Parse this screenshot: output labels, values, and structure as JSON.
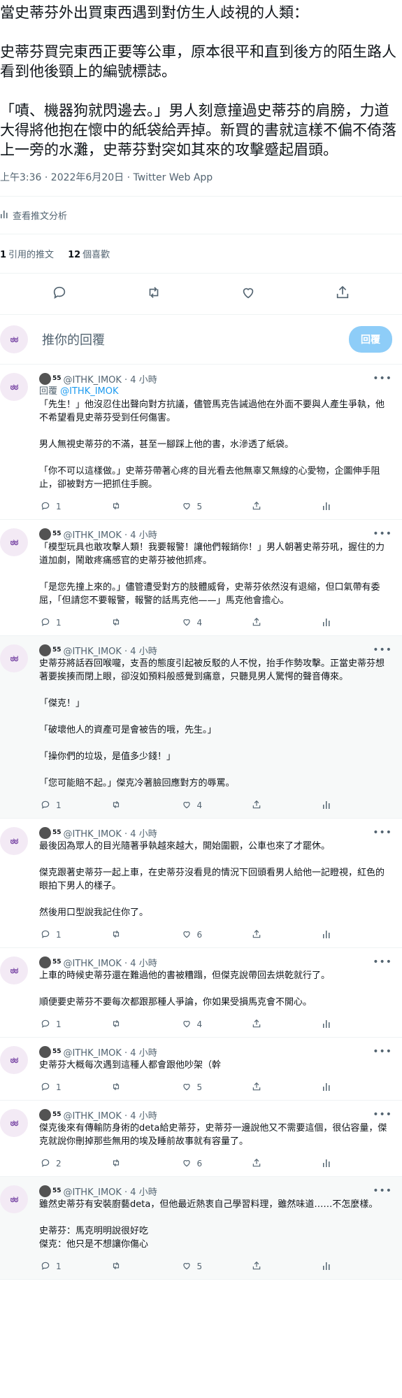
{
  "main_tweet": {
    "paragraphs": [
      "當史蒂芬外出買東西遇到對仿生人歧視的人類：",
      "史蒂芬買完東西正要等公車，原本很平和直到後方的陌生路人看到他後頸上的編號標誌。",
      "「嘖、機器狗就閃邊去。」男人刻意撞過史蒂芬的肩膀，力道大得將他抱在懷中的紙袋給弄掉。新買的書就這樣不偏不倚落上一旁的水灘，史蒂芬對突如其來的攻擊蹙起眉頭。"
    ],
    "timestamp": "上午3:36 · 2022年6月20日 · Twitter Web App",
    "analytics_label": "查看推文分析",
    "quote_count": "1",
    "quote_label": "引用的推文",
    "like_count": "12",
    "like_label": "個喜歡"
  },
  "reply_box": {
    "placeholder": "推你的回覆",
    "button_label": "回覆"
  },
  "avatar_label": "ಠಠ",
  "replies": [
    {
      "sup": "55",
      "handle": "@ITHK_IMOK · 4 小時",
      "reply_to_prefix": "回覆 ",
      "reply_to_handle": "@ITHK_IMOK",
      "paragraphs": [
        "「先生！」他沒忍住出聲向對方抗議，儘管馬克告誡過他在外面不要與人產生爭執，他不希望看見史蒂芬受到任何傷害。",
        "男人無視史蒂芬的不滿，甚至一腳踩上他的書，水滲透了紙袋。",
        "「你不可以這樣做。」史蒂芬帶著心疼的目光看去他無辜又無線的心愛物，企圖伸手阻止，卻被對方一把抓住手腕。"
      ],
      "replies": "1",
      "retweets": "",
      "likes": "5"
    },
    {
      "sup": "55",
      "handle": "@ITHK_IMOK · 4 小時",
      "paragraphs": [
        "「模型玩具也敢攻擊人類！我要報警！讓他們報銷你！」男人朝著史蒂芬吼，握住的力道加劇，鬧敢疼痛感官的史蒂芬被他抓疼。",
        "「是您先撞上來的。」儘管遭受對方的肢體威脅，史蒂芬依然沒有退縮，但口氣帶有委屈，「但請您不要報警，報警的話馬克他——」馬克他會擔心。"
      ],
      "replies": "1",
      "retweets": "",
      "likes": "4"
    },
    {
      "sup": "55",
      "handle": "@ITHK_IMOK · 4 小時",
      "paragraphs": [
        "史蒂芬將話吞回喉嚨，支吾的態度引起被反駁的人不悅，抬手作勢攻擊。正當史蒂芬想著要挨揍而閉上眼，卻沒如預料般感覺到痛意，只聽見男人驚愕的聲音傳來。",
        "「傑克！」",
        "「破壞他人的資產可是會被告的哦，先生。」",
        "「操你們的垃圾，是值多少錢！」",
        "「您可能賠不起。」傑克冷著臉回應對方的辱罵。"
      ],
      "replies": "1",
      "retweets": "",
      "likes": "4"
    },
    {
      "sup": "55",
      "handle": "@ITHK_IMOK · 4 小時",
      "paragraphs": [
        "最後因為眾人的目光隨著爭執越來越大，開始圍觀，公車也來了才罷休。",
        "傑克跟著史蒂芬一起上車，在史蒂芬沒看見的情況下回頭看男人給他一記瞪視，紅色的眼拍下男人的樣子。",
        "然後用口型說我記住你了。"
      ],
      "replies": "1",
      "retweets": "",
      "likes": "6"
    },
    {
      "sup": "55",
      "handle": "@ITHK_IMOK · 4 小時",
      "paragraphs": [
        "上車的時候史蒂芬還在難過他的書被糟蹋，但傑克說帶回去烘乾就行了。",
        "順便要史蒂芬不要每次都跟那種人爭論，你如果受損馬克會不開心。"
      ],
      "replies": "1",
      "retweets": "",
      "likes": "4"
    },
    {
      "sup": "55",
      "handle": "@ITHK_IMOK · 4 小時",
      "paragraphs": [
        "史蒂芬大概每次遇到這種人都會跟他吵架（幹"
      ],
      "replies": "1",
      "retweets": "",
      "likes": "5"
    },
    {
      "sup": "55",
      "handle": "@ITHK_IMOK · 4 小時",
      "paragraphs": [
        "傑克後來有傳輸防身術的deta給史蒂芬，史蒂芬一邊說他又不需要這個，很佔容量，傑克就說你刪掉那些無用的埃及睡前故事就有容量了。"
      ],
      "replies": "2",
      "retweets": "",
      "likes": "6"
    },
    {
      "sup": "55",
      "handle": "@ITHK_IMOK · 4 小時",
      "paragraphs": [
        "雖然史蒂芬有安裝廚藝deta，但他最近熱衷自己學習料理，雖然味道……不怎麼樣。",
        "史蒂芬：馬克明明說很好吃\n傑克：他只是不想讓你傷心"
      ],
      "replies": "1",
      "retweets": "",
      "likes": "5"
    }
  ]
}
